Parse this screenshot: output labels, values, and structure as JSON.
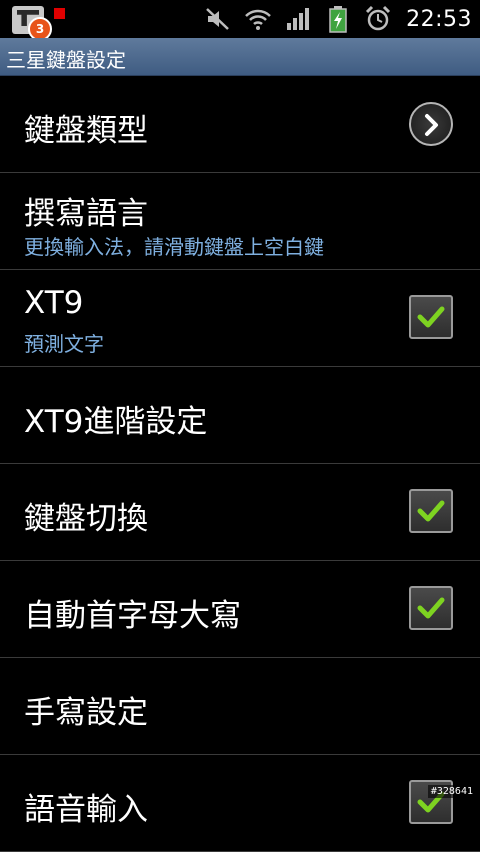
{
  "status_bar": {
    "notification_count": "3",
    "time": "22:53",
    "icons": [
      "app-notification-icon",
      "red-notification-icon",
      "mute-icon",
      "wifi-icon",
      "signal-icon",
      "battery-charging-icon",
      "alarm-icon"
    ]
  },
  "title_bar": {
    "title": "三星鍵盤設定"
  },
  "settings": [
    {
      "label": "鍵盤類型",
      "summary": "",
      "control": "arrow"
    },
    {
      "label": "撰寫語言",
      "summary": "更換輸入法，請滑動鍵盤上空白鍵",
      "control": "none"
    },
    {
      "label": "XT9",
      "summary": "預測文字",
      "control": "checkbox",
      "checked": true
    },
    {
      "label": "XT9進階設定",
      "summary": "",
      "control": "none"
    },
    {
      "label": "鍵盤切換",
      "summary": "",
      "control": "checkbox",
      "checked": true
    },
    {
      "label": "自動首字母大寫",
      "summary": "",
      "control": "checkbox",
      "checked": true
    },
    {
      "label": "手寫設定",
      "summary": "",
      "control": "none"
    },
    {
      "label": "語音輸入",
      "summary": "",
      "control": "checkbox",
      "checked": true
    }
  ],
  "watermark": "#328641",
  "colors": {
    "accent_check": "#7ed321",
    "summary_text": "#7fb0e0",
    "title_bar": "#4d6a90"
  }
}
